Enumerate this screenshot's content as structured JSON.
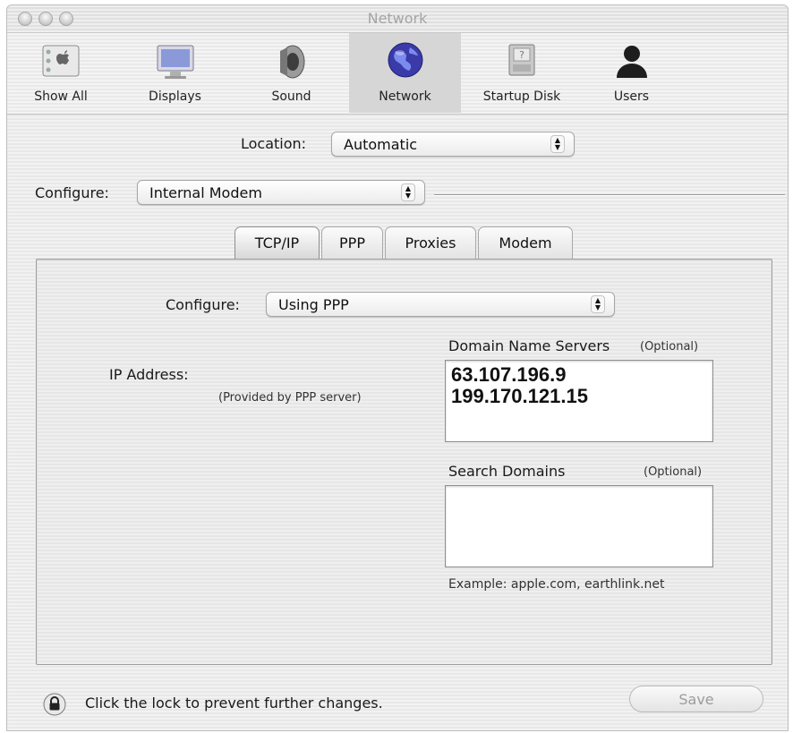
{
  "window": {
    "title": "Network"
  },
  "toolbar": {
    "items": [
      {
        "label": "Show All",
        "icon": "apple-icon"
      },
      {
        "label": "Displays",
        "icon": "display-icon"
      },
      {
        "label": "Sound",
        "icon": "speaker-icon"
      },
      {
        "label": "Network",
        "icon": "globe-icon",
        "selected": true
      },
      {
        "label": "Startup Disk",
        "icon": "disk-icon"
      },
      {
        "label": "Users",
        "icon": "user-icon"
      }
    ]
  },
  "location": {
    "label": "Location:",
    "value": "Automatic"
  },
  "configure_top": {
    "label": "Configure:",
    "value": "Internal Modem"
  },
  "tabs": [
    {
      "label": "TCP/IP",
      "active": true
    },
    {
      "label": "PPP"
    },
    {
      "label": "Proxies"
    },
    {
      "label": "Modem"
    }
  ],
  "tcpip": {
    "configure_label": "Configure:",
    "configure_value": "Using PPP",
    "ip_label": "IP Address:",
    "ip_note": "(Provided by PPP server)",
    "dns_label": "Domain Name Servers",
    "dns_optional": "(Optional)",
    "dns_entries": [
      "63.107.196.9",
      "199.170.121.15"
    ],
    "search_label": "Search Domains",
    "search_optional": "(Optional)",
    "search_value": "",
    "example": "Example: apple.com, earthlink.net"
  },
  "footer": {
    "lock_text": "Click the lock to prevent further changes.",
    "save_label": "Save"
  }
}
